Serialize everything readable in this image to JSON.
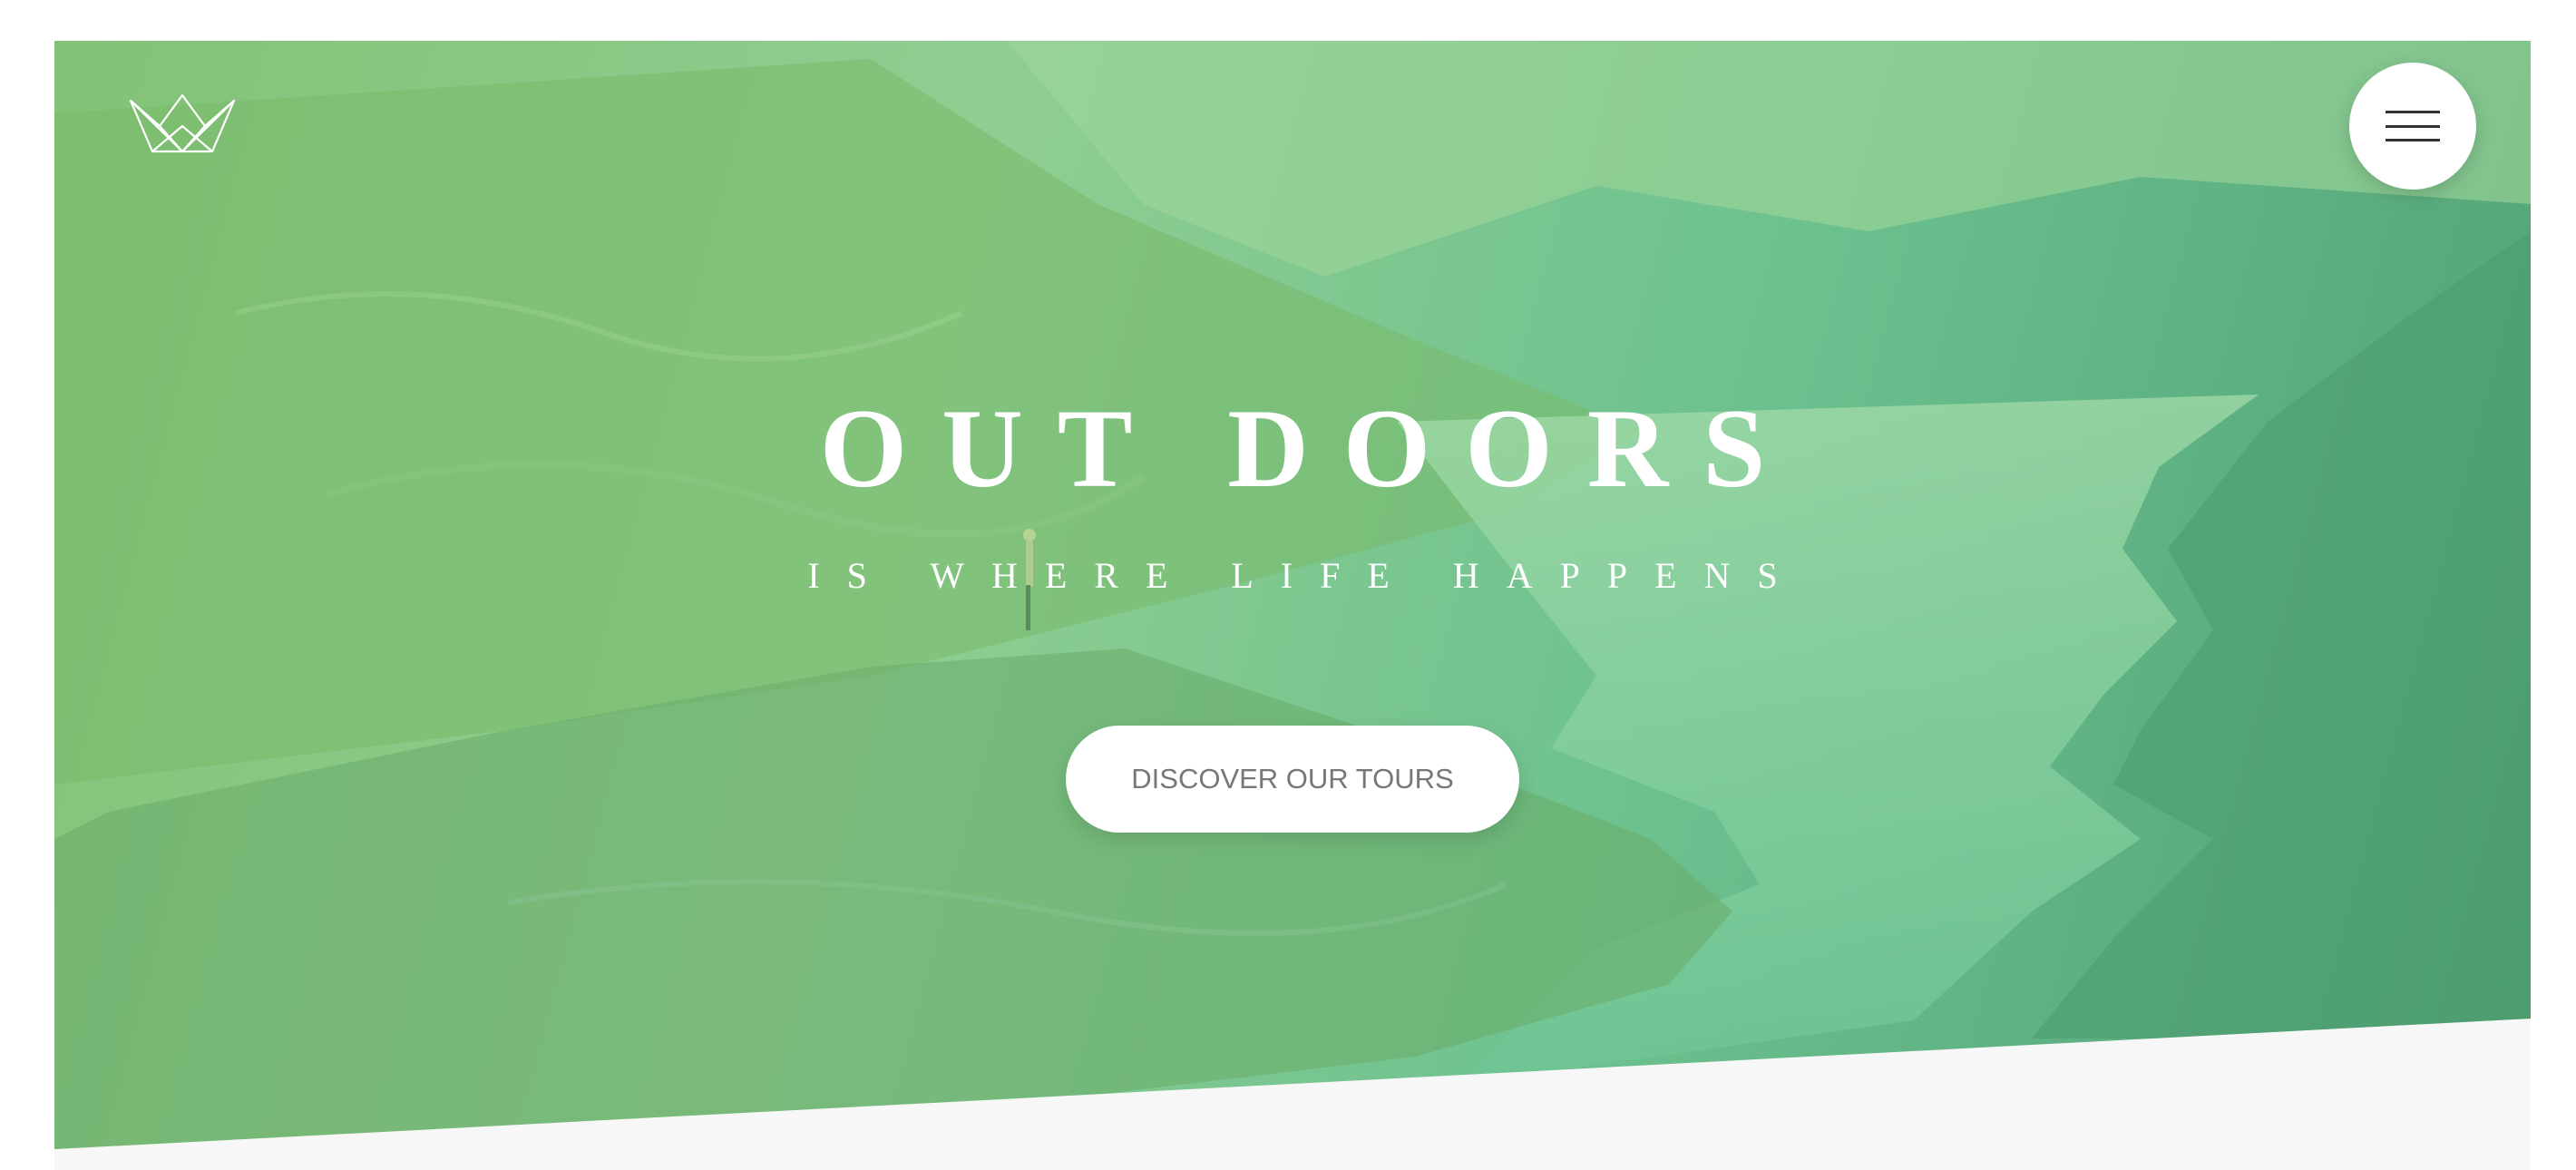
{
  "hero": {
    "title": "OUT DOORS",
    "subtitle": "IS WHERE LIFE HAPPENS",
    "cta_label": "DISCOVER OUR TOURS",
    "gradient_colors": [
      "#82c276",
      "#8fce92",
      "#6cc18f",
      "#4f9f74"
    ]
  },
  "header": {
    "logo_icon": "crown-icon",
    "menu_icon": "hamburger-menu-icon"
  },
  "colors": {
    "page_background": "#f7f7f7",
    "text": "#ffffff",
    "button_text": "#777777"
  }
}
